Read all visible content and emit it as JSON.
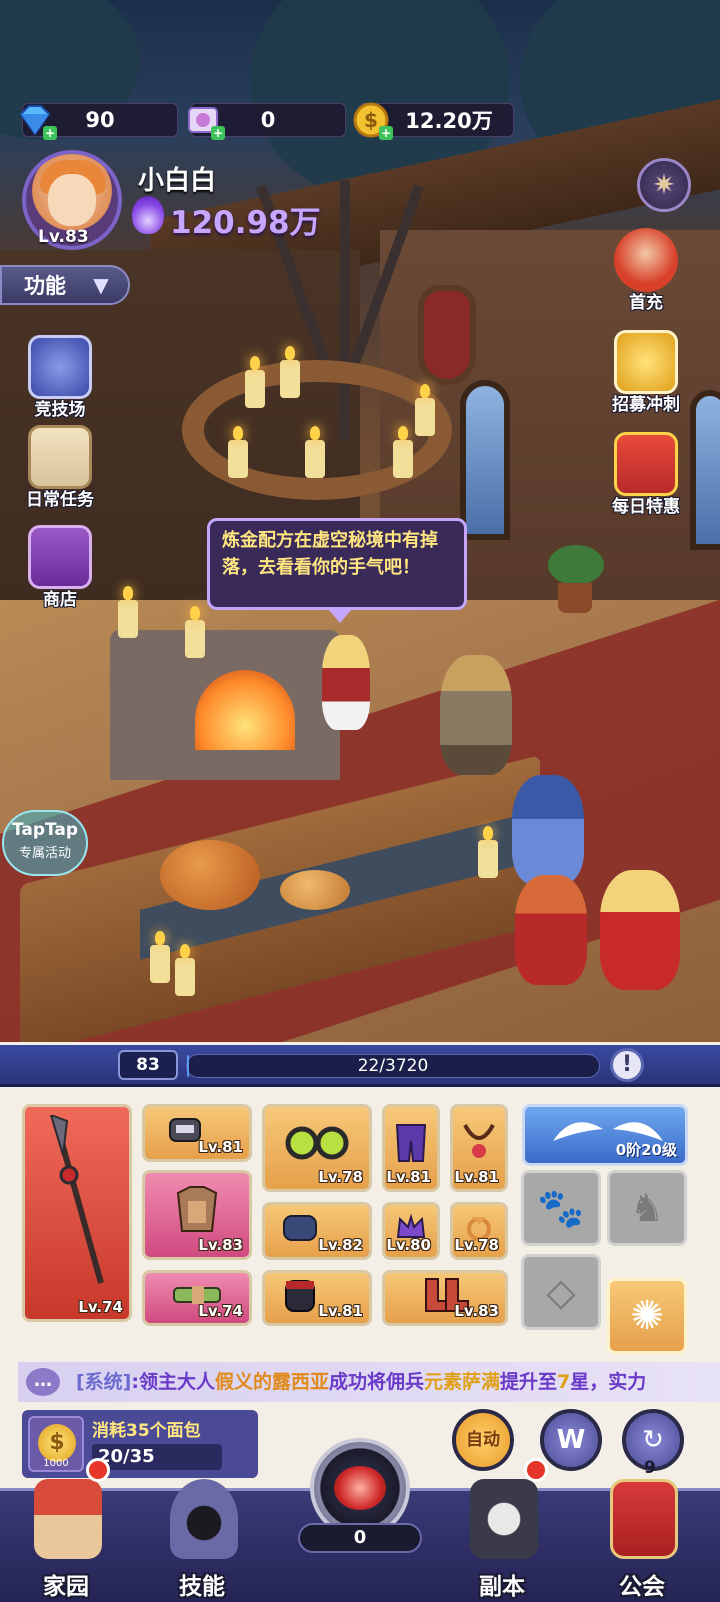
{
  "resources": {
    "diamonds": "90",
    "scrolls": "0",
    "gold": "12.20万"
  },
  "player": {
    "name": "小白白",
    "level": "Lv.83",
    "power": "120.98万"
  },
  "menu": {
    "function_label": "功能"
  },
  "left_side": [
    {
      "label": "竞技场"
    },
    {
      "label": "日常任务"
    },
    {
      "label": "商店"
    }
  ],
  "right_side": [
    {
      "label": "首充"
    },
    {
      "label": "招募冲刺"
    },
    {
      "label": "每日特惠"
    }
  ],
  "npc_dialog": "炼金配方在虚空秘境中有掉落，去看看你的手气吧！",
  "taptap": {
    "brand": "TapTap",
    "subtitle": "专属活动"
  },
  "xp": {
    "level": "83",
    "progress": "22/3720",
    "fraction": 0.006,
    "info_icon": "!"
  },
  "equipment": {
    "weapon": "Lv.74",
    "slots": [
      {
        "icon": "bracer-icon",
        "level": "Lv.81"
      },
      {
        "icon": "goggles-icon",
        "level": "Lv.78"
      },
      {
        "icon": "pants-icon",
        "level": "Lv.81"
      },
      {
        "icon": "necklace-icon",
        "level": "Lv.81"
      },
      {
        "icon": "armor-icon",
        "level": "Lv.83"
      },
      {
        "icon": "gauntlet-icon",
        "level": "Lv.82"
      },
      {
        "icon": "crown-icon",
        "level": "Lv.80"
      },
      {
        "icon": "fox-ring-icon",
        "level": "Lv.78"
      },
      {
        "icon": "belt-icon",
        "level": "Lv.74"
      },
      {
        "icon": "glove-icon",
        "level": "Lv.81"
      },
      {
        "icon": "boots-icon",
        "level": "Lv.83"
      }
    ],
    "wings_level": "0阶20级"
  },
  "ticker": {
    "prefix": "[系统]",
    "part1": ":领主大人",
    "player": "假义的露西亚",
    "part2": "成功将佣兵",
    "hero": "元素萨满",
    "part3": "提升至",
    "star": "7",
    "part4": "星，实力"
  },
  "cost": {
    "coin_amount": "1000",
    "label": "消耗35个面包",
    "progress": "20/35"
  },
  "actions": {
    "auto_label": "自动",
    "w_label": "W",
    "counter": "9"
  },
  "nav": {
    "items": [
      {
        "label": "家园"
      },
      {
        "label": "技能"
      },
      {
        "label": "副本"
      },
      {
        "label": "公会"
      }
    ],
    "bread": "0"
  },
  "colors": {
    "accent_purple": "#7c63c8",
    "power_text": "#c6a6ff",
    "dialog_text": "#ffe680",
    "alert_red": "#e8352a"
  }
}
